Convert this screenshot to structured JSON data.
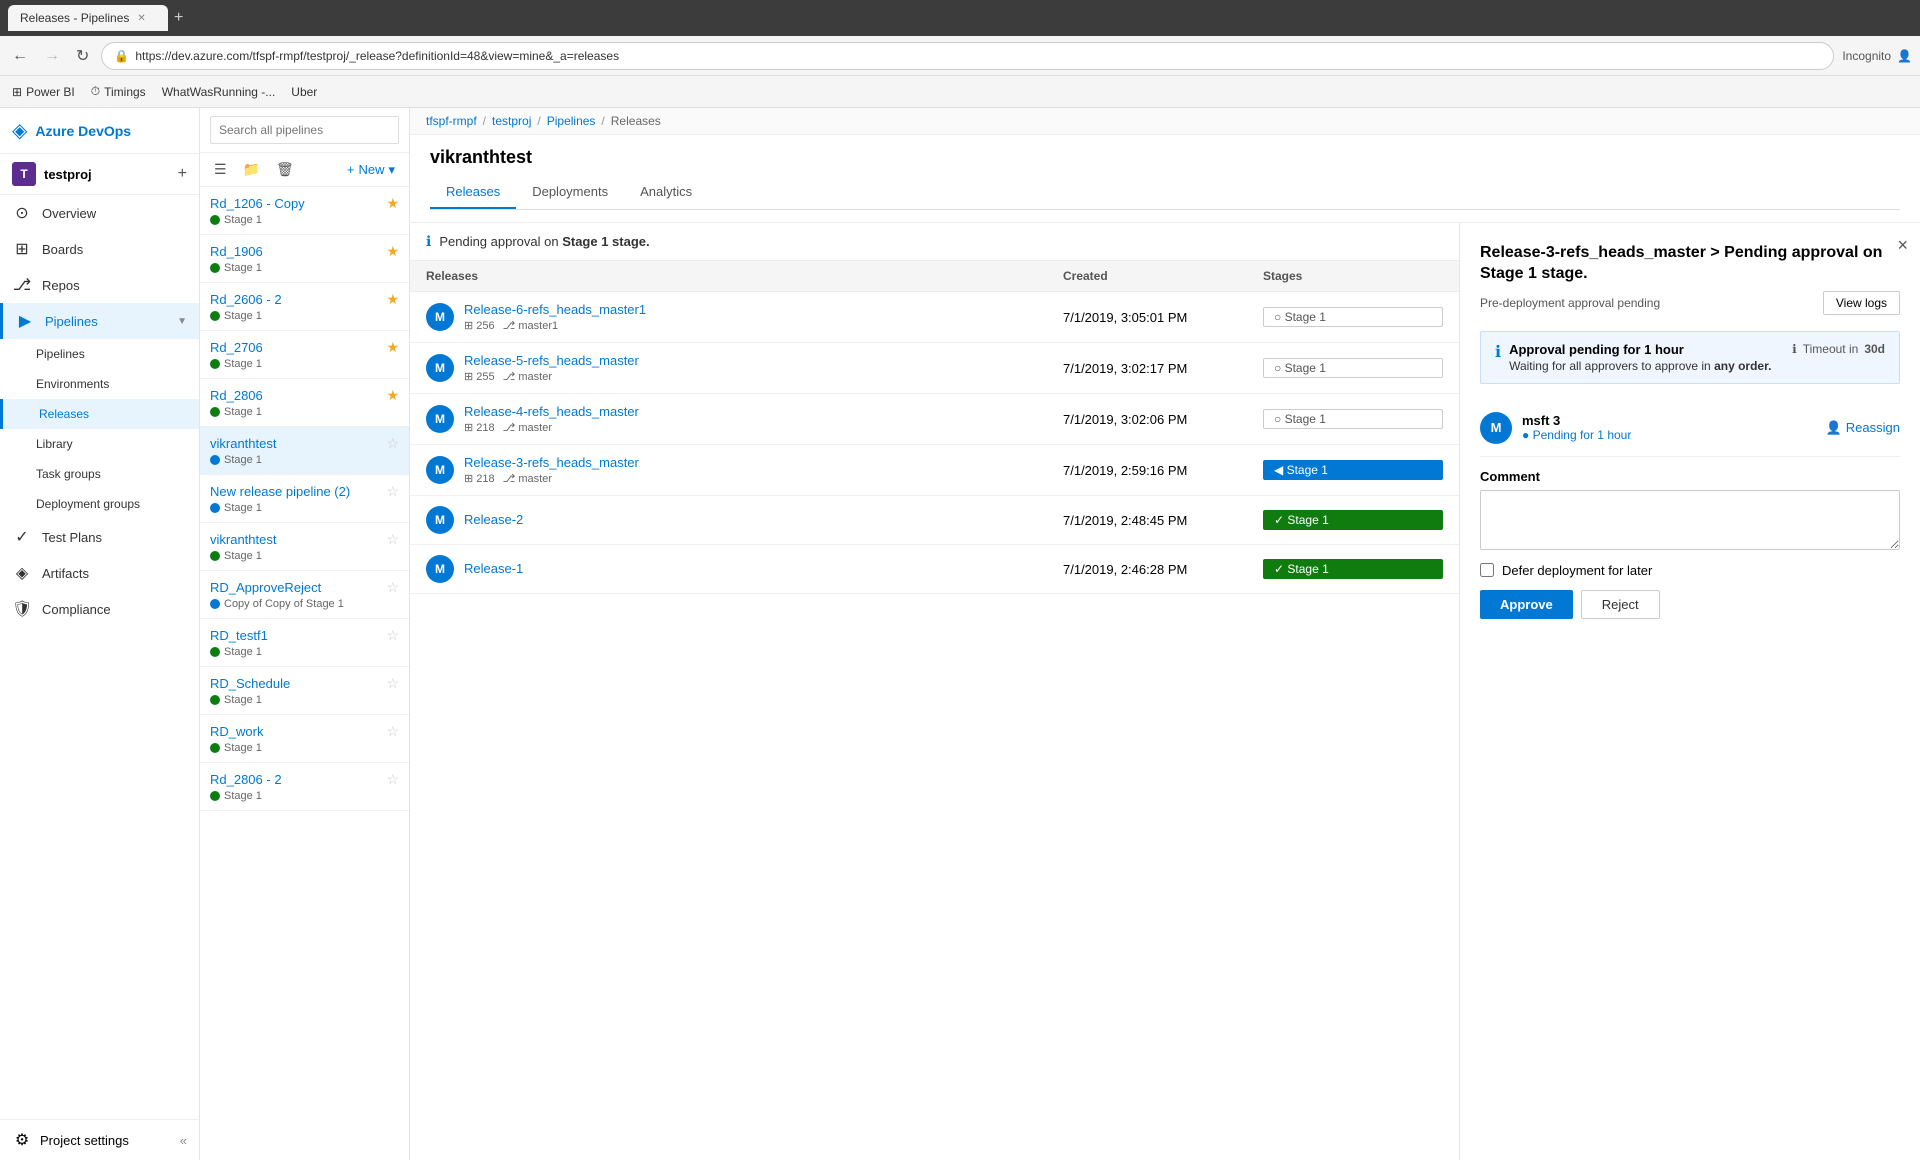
{
  "browser": {
    "tab_title": "Releases - Pipelines",
    "url": "https://dev.azure.com/tfspf-rmpf/testproj/_release?definitionId=48&view=mine&_a=releases",
    "bookmarks": [
      "Power BI",
      "Timings",
      "WhatWasRunning -...",
      "Uber"
    ]
  },
  "breadcrumb": {
    "items": [
      "tfspf-rmpf",
      "testproj",
      "Pipelines",
      "Releases"
    ]
  },
  "sidebar": {
    "logo": "Azure DevOps",
    "project": "testproj",
    "project_initial": "T",
    "nav_items": [
      {
        "id": "overview",
        "label": "Overview",
        "icon": "⊙"
      },
      {
        "id": "boards",
        "label": "Boards",
        "icon": "⊞"
      },
      {
        "id": "repos",
        "label": "Repos",
        "icon": "⎇"
      },
      {
        "id": "pipelines",
        "label": "Pipelines",
        "icon": "▶",
        "active": true,
        "expanded": true
      },
      {
        "id": "pipelines-sub",
        "label": "Pipelines",
        "icon": "",
        "sub": true
      },
      {
        "id": "environments-sub",
        "label": "Environments",
        "icon": "",
        "sub": true
      },
      {
        "id": "releases-sub",
        "label": "Releases",
        "icon": "",
        "sub": true,
        "active": true
      },
      {
        "id": "library-sub",
        "label": "Library",
        "icon": "",
        "sub": true
      },
      {
        "id": "task-groups-sub",
        "label": "Task groups",
        "icon": "",
        "sub": true
      },
      {
        "id": "deployment-groups-sub",
        "label": "Deployment groups",
        "icon": "",
        "sub": true
      },
      {
        "id": "test-plans",
        "label": "Test Plans",
        "icon": "✓"
      },
      {
        "id": "artifacts",
        "label": "Artifacts",
        "icon": "◈"
      },
      {
        "id": "compliance",
        "label": "Compliance",
        "icon": "🛡"
      }
    ],
    "footer": {
      "label": "Project settings",
      "icon": "⚙"
    }
  },
  "pipeline_list": {
    "search_placeholder": "Search all pipelines",
    "new_label": "New",
    "items": [
      {
        "name": "Rd_1206 - Copy",
        "stage": "Stage 1",
        "starred": true,
        "status": "green"
      },
      {
        "name": "Rd_1906",
        "stage": "Stage 1",
        "starred": true,
        "status": "green"
      },
      {
        "name": "Rd_2606 - 2",
        "stage": "Stage 1",
        "starred": true,
        "status": "green"
      },
      {
        "name": "Rd_2706",
        "stage": "Stage 1",
        "starred": true,
        "status": "green"
      },
      {
        "name": "Rd_2806",
        "stage": "Stage 1",
        "starred": true,
        "status": "green"
      },
      {
        "name": "vikranthtest",
        "stage": "Stage 1",
        "starred": false,
        "status": "blue",
        "active": true
      },
      {
        "name": "New release pipeline (2)",
        "stage": "Stage 1",
        "starred": false,
        "status": "blue"
      },
      {
        "name": "vikranthtest",
        "stage": "Stage 1",
        "starred": false,
        "status": "green"
      },
      {
        "name": "RD_ApproveReject",
        "stage": "Copy of Copy of Stage 1",
        "starred": false,
        "status": "blue"
      },
      {
        "name": "RD_testf1",
        "stage": "Stage 1",
        "starred": false,
        "status": "green"
      },
      {
        "name": "RD_Schedule",
        "stage": "Stage 1",
        "starred": false,
        "status": "green"
      },
      {
        "name": "RD_work",
        "stage": "Stage 1",
        "starred": false,
        "status": "green"
      },
      {
        "name": "Rd_2806 - 2",
        "stage": "Stage 1",
        "starred": false,
        "status": "green"
      }
    ]
  },
  "release_detail": {
    "title": "vikranthtest",
    "tabs": [
      "Releases",
      "Deployments",
      "Analytics"
    ],
    "active_tab": "Releases",
    "pending_notice": "Pending approval on Stage 1 stage.",
    "table_headers": [
      "Releases",
      "Created",
      "Stages"
    ],
    "releases": [
      {
        "avatar": "M",
        "name": "Release-6-refs_heads_master1",
        "build": "256",
        "branch": "master1",
        "created": "7/1/2019, 3:05:01 PM",
        "stage": "Stage 1",
        "stage_style": "default"
      },
      {
        "avatar": "M",
        "name": "Release-5-refs_heads_master",
        "build": "255",
        "branch": "master",
        "created": "7/1/2019, 3:02:17 PM",
        "stage": "Stage 1",
        "stage_style": "default"
      },
      {
        "avatar": "M",
        "name": "Release-4-refs_heads_master",
        "build": "218",
        "branch": "master",
        "created": "7/1/2019, 3:02:06 PM",
        "stage": "Stage 1",
        "stage_style": "default"
      },
      {
        "avatar": "M",
        "name": "Release-3-refs_heads_master",
        "build": "218",
        "branch": "master",
        "created": "7/1/2019, 2:59:16 PM",
        "stage": "Stage 1",
        "stage_style": "blue"
      },
      {
        "avatar": "M",
        "name": "Release-2",
        "build": "",
        "branch": "",
        "created": "7/1/2019, 2:48:45 PM",
        "stage": "Stage 1",
        "stage_style": "green"
      },
      {
        "avatar": "M",
        "name": "Release-1",
        "build": "",
        "branch": "",
        "created": "7/1/2019, 2:46:28 PM",
        "stage": "Stage 1",
        "stage_style": "green"
      }
    ]
  },
  "approval_panel": {
    "title": "Release-3-refs_heads_master > Pending approval on Stage 1 stage.",
    "subtitle": "Pre-deployment approval pending",
    "view_logs_label": "View logs",
    "approval_info": {
      "pending_text": "Approval pending for 1 hour",
      "waiting_text": "Waiting for all approvers to approve in",
      "bold_text": "any order.",
      "timeout_text": "Timeout in",
      "timeout_value": "30d"
    },
    "approver": {
      "name": "msft 3",
      "initial": "M",
      "status": "Pending for 1 hour",
      "reassign_label": "Reassign"
    },
    "comment_label": "Comment",
    "comment_placeholder": "",
    "defer_label": "Defer deployment for later",
    "approve_label": "Approve",
    "reject_label": "Reject",
    "close_label": "×"
  }
}
